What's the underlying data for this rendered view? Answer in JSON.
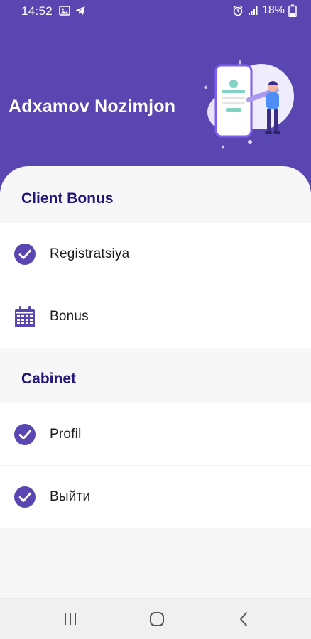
{
  "status_bar": {
    "time": "14:52",
    "battery": "18%",
    "left_icons": [
      "image-icon",
      "telegram-icon"
    ],
    "right_icons": [
      "alarm-icon",
      "signal-icon",
      "battery-icon"
    ]
  },
  "header": {
    "user_name": "Adxamov Nozimjon",
    "illustration": "phone-registration-illustration"
  },
  "sections": [
    {
      "title": "Client Bonus",
      "items": [
        {
          "label": "Registratsiya",
          "icon": "check-circle-icon"
        },
        {
          "label": "Bonus",
          "icon": "calendar-icon"
        }
      ]
    },
    {
      "title": "Cabinet",
      "items": [
        {
          "label": "Profil",
          "icon": "check-circle-icon"
        },
        {
          "label": "Выйти",
          "icon": "check-circle-icon"
        }
      ]
    }
  ],
  "nav_bar": {
    "buttons": [
      "recent-apps-icon",
      "home-icon",
      "back-icon"
    ]
  },
  "colors": {
    "accent": "#5a46b0",
    "section_title": "#23157a",
    "background": "#f7f7f7"
  }
}
